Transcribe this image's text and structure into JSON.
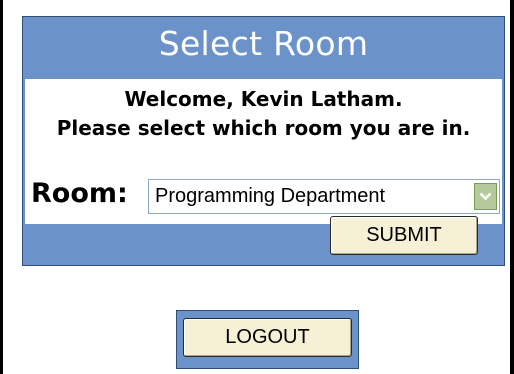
{
  "panel": {
    "title": "Select Room",
    "welcome_line": "Welcome, Kevin Latham.",
    "instruction_line": "Please select which room you are in."
  },
  "room": {
    "label": "Room:",
    "selected_value": "Programming Department",
    "arrow_icon": "chevron-down-icon"
  },
  "buttons": {
    "submit_label": "SUBMIT",
    "logout_label": "LOGOUT"
  },
  "colors": {
    "panel_blue": "#6b93c9",
    "button_fill": "#f5f0d6",
    "select_arrow_green": "#b6c99a"
  }
}
